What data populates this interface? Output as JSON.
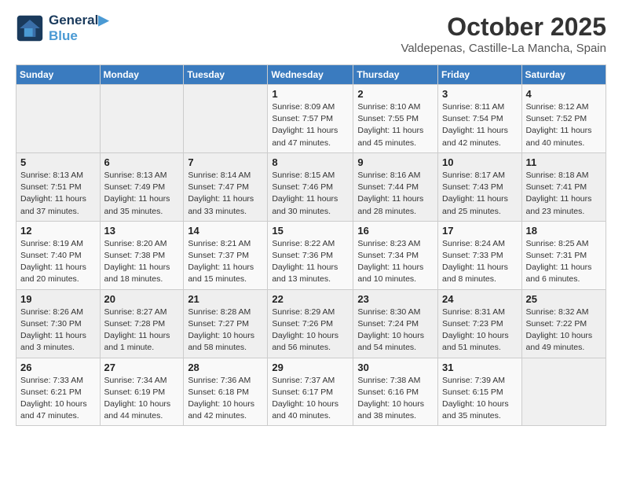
{
  "header": {
    "logo_line1": "General",
    "logo_line2": "Blue",
    "month": "October 2025",
    "location": "Valdepenas, Castille-La Mancha, Spain"
  },
  "days_of_week": [
    "Sunday",
    "Monday",
    "Tuesday",
    "Wednesday",
    "Thursday",
    "Friday",
    "Saturday"
  ],
  "weeks": [
    [
      {
        "day": "",
        "info": ""
      },
      {
        "day": "",
        "info": ""
      },
      {
        "day": "",
        "info": ""
      },
      {
        "day": "1",
        "info": "Sunrise: 8:09 AM\nSunset: 7:57 PM\nDaylight: 11 hours and 47 minutes."
      },
      {
        "day": "2",
        "info": "Sunrise: 8:10 AM\nSunset: 7:55 PM\nDaylight: 11 hours and 45 minutes."
      },
      {
        "day": "3",
        "info": "Sunrise: 8:11 AM\nSunset: 7:54 PM\nDaylight: 11 hours and 42 minutes."
      },
      {
        "day": "4",
        "info": "Sunrise: 8:12 AM\nSunset: 7:52 PM\nDaylight: 11 hours and 40 minutes."
      }
    ],
    [
      {
        "day": "5",
        "info": "Sunrise: 8:13 AM\nSunset: 7:51 PM\nDaylight: 11 hours and 37 minutes."
      },
      {
        "day": "6",
        "info": "Sunrise: 8:13 AM\nSunset: 7:49 PM\nDaylight: 11 hours and 35 minutes."
      },
      {
        "day": "7",
        "info": "Sunrise: 8:14 AM\nSunset: 7:47 PM\nDaylight: 11 hours and 33 minutes."
      },
      {
        "day": "8",
        "info": "Sunrise: 8:15 AM\nSunset: 7:46 PM\nDaylight: 11 hours and 30 minutes."
      },
      {
        "day": "9",
        "info": "Sunrise: 8:16 AM\nSunset: 7:44 PM\nDaylight: 11 hours and 28 minutes."
      },
      {
        "day": "10",
        "info": "Sunrise: 8:17 AM\nSunset: 7:43 PM\nDaylight: 11 hours and 25 minutes."
      },
      {
        "day": "11",
        "info": "Sunrise: 8:18 AM\nSunset: 7:41 PM\nDaylight: 11 hours and 23 minutes."
      }
    ],
    [
      {
        "day": "12",
        "info": "Sunrise: 8:19 AM\nSunset: 7:40 PM\nDaylight: 11 hours and 20 minutes."
      },
      {
        "day": "13",
        "info": "Sunrise: 8:20 AM\nSunset: 7:38 PM\nDaylight: 11 hours and 18 minutes."
      },
      {
        "day": "14",
        "info": "Sunrise: 8:21 AM\nSunset: 7:37 PM\nDaylight: 11 hours and 15 minutes."
      },
      {
        "day": "15",
        "info": "Sunrise: 8:22 AM\nSunset: 7:36 PM\nDaylight: 11 hours and 13 minutes."
      },
      {
        "day": "16",
        "info": "Sunrise: 8:23 AM\nSunset: 7:34 PM\nDaylight: 11 hours and 10 minutes."
      },
      {
        "day": "17",
        "info": "Sunrise: 8:24 AM\nSunset: 7:33 PM\nDaylight: 11 hours and 8 minutes."
      },
      {
        "day": "18",
        "info": "Sunrise: 8:25 AM\nSunset: 7:31 PM\nDaylight: 11 hours and 6 minutes."
      }
    ],
    [
      {
        "day": "19",
        "info": "Sunrise: 8:26 AM\nSunset: 7:30 PM\nDaylight: 11 hours and 3 minutes."
      },
      {
        "day": "20",
        "info": "Sunrise: 8:27 AM\nSunset: 7:28 PM\nDaylight: 11 hours and 1 minute."
      },
      {
        "day": "21",
        "info": "Sunrise: 8:28 AM\nSunset: 7:27 PM\nDaylight: 10 hours and 58 minutes."
      },
      {
        "day": "22",
        "info": "Sunrise: 8:29 AM\nSunset: 7:26 PM\nDaylight: 10 hours and 56 minutes."
      },
      {
        "day": "23",
        "info": "Sunrise: 8:30 AM\nSunset: 7:24 PM\nDaylight: 10 hours and 54 minutes."
      },
      {
        "day": "24",
        "info": "Sunrise: 8:31 AM\nSunset: 7:23 PM\nDaylight: 10 hours and 51 minutes."
      },
      {
        "day": "25",
        "info": "Sunrise: 8:32 AM\nSunset: 7:22 PM\nDaylight: 10 hours and 49 minutes."
      }
    ],
    [
      {
        "day": "26",
        "info": "Sunrise: 7:33 AM\nSunset: 6:21 PM\nDaylight: 10 hours and 47 minutes."
      },
      {
        "day": "27",
        "info": "Sunrise: 7:34 AM\nSunset: 6:19 PM\nDaylight: 10 hours and 44 minutes."
      },
      {
        "day": "28",
        "info": "Sunrise: 7:36 AM\nSunset: 6:18 PM\nDaylight: 10 hours and 42 minutes."
      },
      {
        "day": "29",
        "info": "Sunrise: 7:37 AM\nSunset: 6:17 PM\nDaylight: 10 hours and 40 minutes."
      },
      {
        "day": "30",
        "info": "Sunrise: 7:38 AM\nSunset: 6:16 PM\nDaylight: 10 hours and 38 minutes."
      },
      {
        "day": "31",
        "info": "Sunrise: 7:39 AM\nSunset: 6:15 PM\nDaylight: 10 hours and 35 minutes."
      },
      {
        "day": "",
        "info": ""
      }
    ]
  ]
}
